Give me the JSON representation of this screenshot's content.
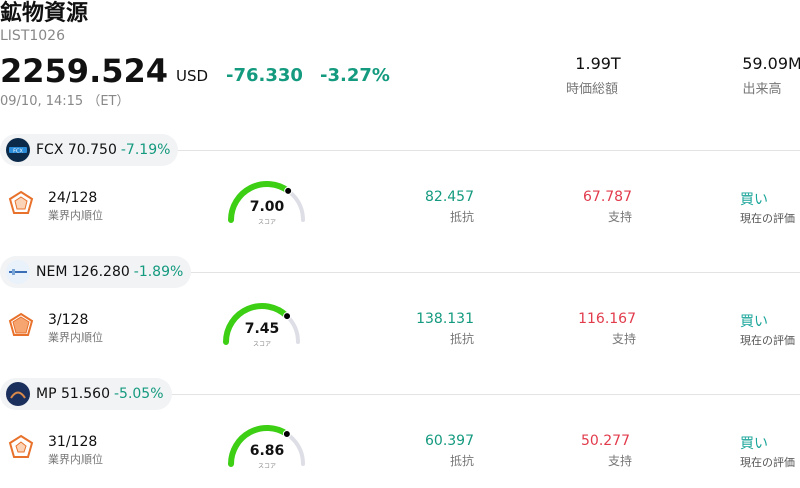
{
  "header": {
    "title": "鉱物資源",
    "list_id": "LIST1026",
    "price": "2259.524",
    "currency": "USD",
    "change": "-76.330",
    "change_pct": "-3.27%",
    "time": "09/10, 14:15 （ET）",
    "stats": [
      {
        "value": "1.99T",
        "label": "時価総額"
      },
      {
        "value": "59.09M",
        "label": "出来高"
      }
    ]
  },
  "labels": {
    "rank": "業界内順位",
    "score": "スコア",
    "resistance": "抵抗",
    "support": "支持",
    "rating": "現在の評価"
  },
  "stocks": [
    {
      "ticker": "FCX",
      "price": "70.750",
      "pct": "-7.19%",
      "rank": "24/128",
      "score": "7.00",
      "score_value": 7.0,
      "resistance": "82.457",
      "support": "67.787",
      "rating": "買い",
      "logo_color": "#0b2a4a"
    },
    {
      "ticker": "NEM",
      "price": "126.280",
      "pct": "-1.89%",
      "rank": "3/128",
      "score": "7.45",
      "score_value": 7.45,
      "resistance": "138.131",
      "support": "116.167",
      "rating": "買い",
      "logo_color": "#e9f1fb"
    },
    {
      "ticker": "MP",
      "price": "51.560",
      "pct": "-5.05%",
      "rank": "31/128",
      "score": "6.86",
      "score_value": 6.86,
      "resistance": "60.397",
      "support": "50.277",
      "rating": "買い",
      "logo_color": "#1b2f5c"
    }
  ],
  "colors": {
    "positive": "#149a7f",
    "negative": "#e23b4c",
    "gauge_fill": "#3ccf14",
    "gauge_track": "#dedfe6",
    "rating": "#1aa59a"
  }
}
